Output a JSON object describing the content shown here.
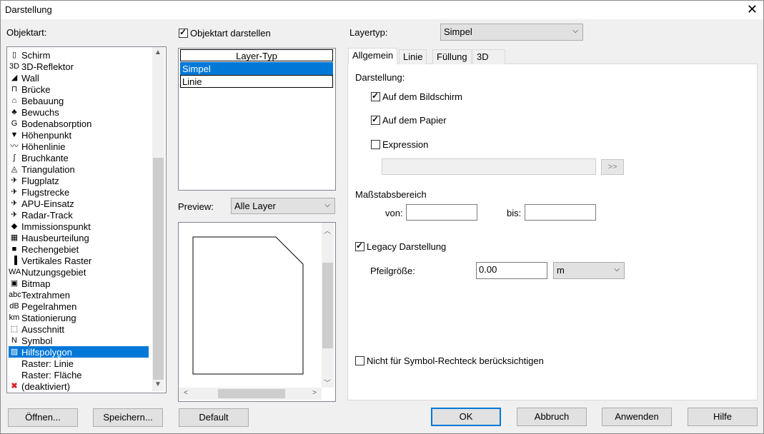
{
  "window": {
    "title": "Darstellung"
  },
  "objektart": {
    "label": "Objektart:",
    "items": [
      {
        "label": "Schirm",
        "icon": "▯"
      },
      {
        "label": "3D-Reflektor",
        "icon": "3D"
      },
      {
        "label": "Wall",
        "icon": "◢"
      },
      {
        "label": "Brücke",
        "icon": "⊓"
      },
      {
        "label": "Bebauung",
        "icon": "⌂"
      },
      {
        "label": "Bewuchs",
        "icon": "♣"
      },
      {
        "label": "Bodenabsorption",
        "icon": "G"
      },
      {
        "label": "Höhenpunkt",
        "icon": "▼"
      },
      {
        "label": "Höhenlinie",
        "icon": "〰"
      },
      {
        "label": "Bruchkante",
        "icon": "ʃ"
      },
      {
        "label": "Triangulation",
        "icon": "◬"
      },
      {
        "label": "Flugplatz",
        "icon": "✈"
      },
      {
        "label": "Flugstrecke",
        "icon": "✈"
      },
      {
        "label": "APU-Einsatz",
        "icon": "✈"
      },
      {
        "label": "Radar-Track",
        "icon": "✈"
      },
      {
        "label": "Immissionspunkt",
        "icon": "◆"
      },
      {
        "label": "Hausbeurteilung",
        "icon": "▦"
      },
      {
        "label": "Rechengebiet",
        "icon": "■"
      },
      {
        "label": "Vertikales Raster",
        "icon": "▐"
      },
      {
        "label": "Nutzungsgebiet",
        "icon": "WA"
      },
      {
        "label": "Bitmap",
        "icon": "▣"
      },
      {
        "label": "Textrahmen",
        "icon": "abc"
      },
      {
        "label": "Pegelrahmen",
        "icon": "dB"
      },
      {
        "label": "Stationierung",
        "icon": "km"
      },
      {
        "label": "Ausschnitt",
        "icon": "⬚"
      },
      {
        "label": "Symbol",
        "icon": "N"
      },
      {
        "label": "Hilfspolygon",
        "icon": "▨"
      },
      {
        "label": "Raster: Linie",
        "icon": ""
      },
      {
        "label": "Raster: Fläche",
        "icon": ""
      },
      {
        "label": "(deaktiviert)",
        "icon": "✖"
      }
    ],
    "selected_index": 26
  },
  "objektart_darstellen": {
    "label": "Objektart darstellen",
    "checked": true
  },
  "layer_grid": {
    "header": "Layer-Typ",
    "rows": [
      "Simpel",
      "Linie"
    ],
    "selected_index": 0
  },
  "preview": {
    "label": "Preview:",
    "combo_value": "Alle Layer"
  },
  "layertyp": {
    "label": "Layertyp:",
    "combo_value": "Simpel"
  },
  "tabs": [
    "Allgemein",
    "Linie",
    "Füllung",
    "3D"
  ],
  "active_tab": 0,
  "darstellung": {
    "label": "Darstellung:",
    "bildschirm": {
      "label": "Auf dem Bildschirm",
      "checked": true
    },
    "papier": {
      "label": "Auf dem Papier",
      "checked": true
    },
    "expression": {
      "label": "Expression",
      "checked": false
    },
    "expression_value": "",
    "expr_button": ">>"
  },
  "massstab": {
    "label": "Maßstabsbereich",
    "von_label": "von:",
    "von_value": "",
    "bis_label": "bis:",
    "bis_value": ""
  },
  "legacy": {
    "label": "Legacy Darstellung",
    "checked": true
  },
  "pfeil": {
    "label": "Pfeilgröße:",
    "value": "0.00",
    "unit": "m"
  },
  "nicht_symbol": {
    "label": "Nicht für Symbol-Rechteck berücksichtigen",
    "checked": false
  },
  "buttons": {
    "oeffnen": "Öffnen...",
    "speichern": "Speichern...",
    "default": "Default",
    "ok": "OK",
    "abbruch": "Abbruch",
    "anwenden": "Anwenden",
    "hilfe": "Hilfe"
  }
}
